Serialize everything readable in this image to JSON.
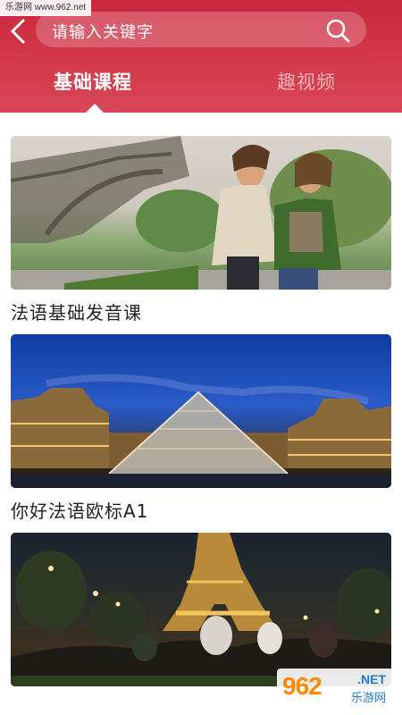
{
  "watermark_top": "乐游网 www.962.net",
  "search": {
    "placeholder": "请输入关键字"
  },
  "tabs": [
    {
      "label": "基础课程",
      "active": true
    },
    {
      "label": "趣视频",
      "active": false
    }
  ],
  "courses": [
    {
      "title": "法语基础发音课",
      "image": "eiffel-tower-women-photo"
    },
    {
      "title": "你好法语欧标A1",
      "image": "louvre-pyramid-night-photo"
    },
    {
      "title": "",
      "image": "eiffel-tower-night-crowd-photo"
    }
  ],
  "watermark_bottom": {
    "logo_text": "962",
    "net_text": ".NET",
    "cn_text": "乐游网"
  },
  "colors": {
    "header": "#d03446",
    "tab_inactive": "rgba(255,255,255,0.6)",
    "text": "#222222"
  },
  "icons": {
    "back": "chevron-left-icon",
    "search": "search-icon"
  }
}
